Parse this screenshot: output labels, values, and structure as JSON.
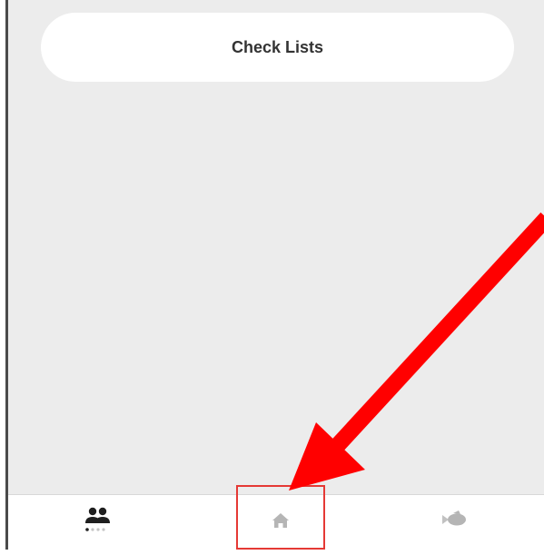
{
  "main": {
    "checklists_label": "Check Lists"
  },
  "bottom_nav": {
    "items": [
      {
        "icon": "people-icon",
        "active": true
      },
      {
        "icon": "home-icon",
        "active": false
      },
      {
        "icon": "fish-icon",
        "active": false
      }
    ]
  },
  "annotation": {
    "arrow_color": "#ff0000",
    "box_color": "#e53935"
  },
  "colors": {
    "content_bg": "#ececec",
    "card_bg": "#ffffff",
    "active_icon": "#1f1f1f",
    "inactive_icon": "#b5b5b5"
  }
}
